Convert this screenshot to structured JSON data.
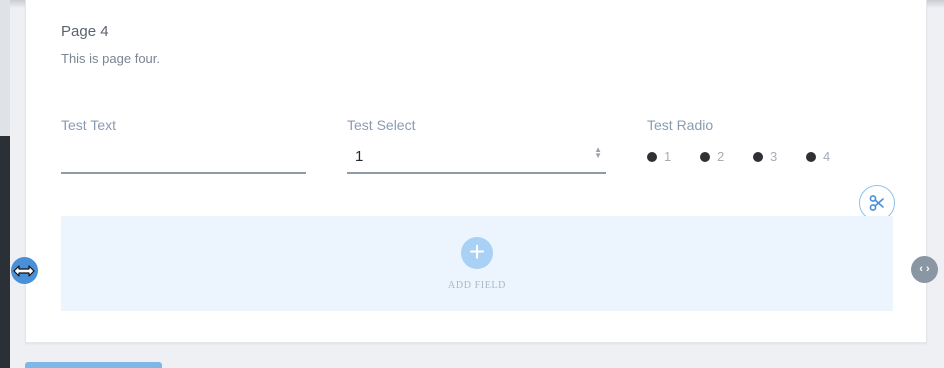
{
  "page": {
    "title": "Page 4",
    "description": "This is page four."
  },
  "fields": {
    "text": {
      "label": "Test Text",
      "value": ""
    },
    "select": {
      "label": "Test Select",
      "value": "1"
    },
    "radio": {
      "label": "Test Radio",
      "options": [
        "1",
        "2",
        "3",
        "4"
      ]
    }
  },
  "drop_zone": {
    "add_label": "ADD FIELD",
    "add_icon": "plus-icon"
  },
  "controls": {
    "scissors_icon": "scissors-icon",
    "resize_left_icon": "horizontal-resize-cursor-icon",
    "resize_right_icon": "code-brackets-icon",
    "resize_right_glyph": "‹ ›"
  },
  "colors": {
    "accent": "#4a90d9",
    "drop_zone_bg": "#ecf4fd",
    "add_icon_bg": "#a8d1f5"
  }
}
